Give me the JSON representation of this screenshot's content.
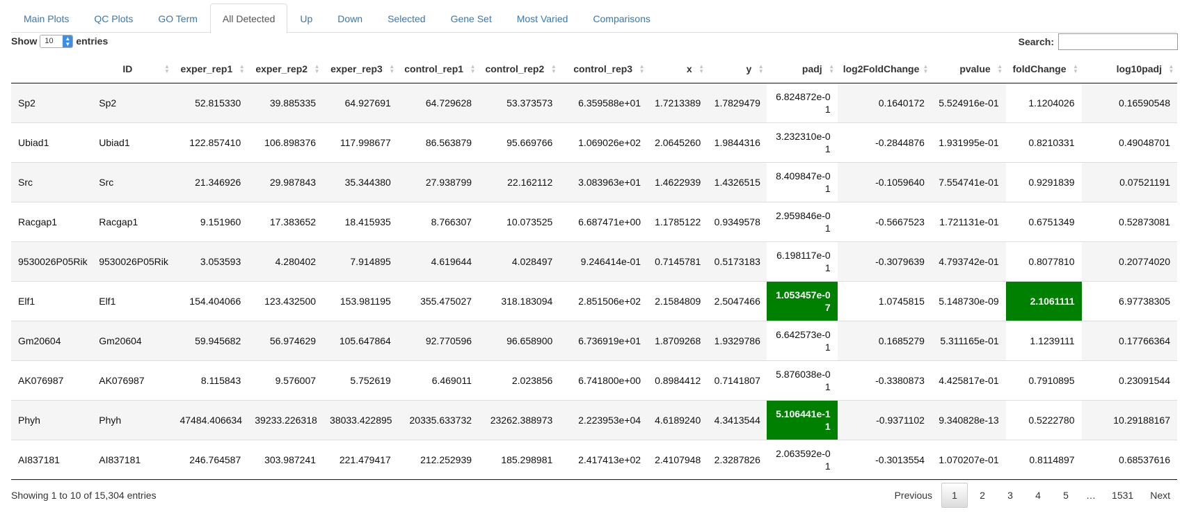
{
  "tabs": [
    {
      "label": "Main Plots",
      "active": false
    },
    {
      "label": "QC Plots",
      "active": false
    },
    {
      "label": "GO Term",
      "active": false
    },
    {
      "label": "All Detected",
      "active": true
    },
    {
      "label": "Up",
      "active": false
    },
    {
      "label": "Down",
      "active": false
    },
    {
      "label": "Selected",
      "active": false
    },
    {
      "label": "Gene Set",
      "active": false
    },
    {
      "label": "Most Varied",
      "active": false
    },
    {
      "label": "Comparisons",
      "active": false
    }
  ],
  "length": {
    "show_label": "Show",
    "value": "10",
    "entries_label": "entries"
  },
  "search": {
    "label": "Search:",
    "value": ""
  },
  "table": {
    "headers": [
      "",
      "ID",
      "exper_rep1",
      "exper_rep2",
      "exper_rep3",
      "control_rep1",
      "control_rep2",
      "control_rep3",
      "x",
      "y",
      "padj",
      "log2FoldChange",
      "pvalue",
      "foldChange",
      "log10padj"
    ],
    "rows": [
      [
        "Sp2",
        "Sp2",
        "52.815330",
        "39.885335",
        "64.927691",
        "64.729628",
        "53.373573",
        "6.359588e+01",
        "1.7213389",
        "1.7829479",
        "6.824872e-01",
        "0.1640172",
        "5.524916e-01",
        "1.1204026",
        "0.16590548"
      ],
      [
        "Ubiad1",
        "Ubiad1",
        "122.857410",
        "106.898376",
        "117.998677",
        "86.563879",
        "95.669766",
        "1.069026e+02",
        "2.0645260",
        "1.9844316",
        "3.232310e-01",
        "-0.2844876",
        "1.931995e-01",
        "0.8210331",
        "0.49048701"
      ],
      [
        "Src",
        "Src",
        "21.346926",
        "29.987843",
        "35.344380",
        "27.938799",
        "22.162112",
        "3.083963e+01",
        "1.4622939",
        "1.4326515",
        "8.409847e-01",
        "-0.1059640",
        "7.554741e-01",
        "0.9291839",
        "0.07521191"
      ],
      [
        "Racgap1",
        "Racgap1",
        "9.151960",
        "17.383652",
        "18.415935",
        "8.766307",
        "10.073525",
        "6.687471e+00",
        "1.1785122",
        "0.9349578",
        "2.959846e-01",
        "-0.5667523",
        "1.721131e-01",
        "0.6751349",
        "0.52873081"
      ],
      [
        "9530026P05Rik",
        "9530026P05Rik",
        "3.053593",
        "4.280402",
        "7.914895",
        "4.619644",
        "4.028497",
        "9.246414e-01",
        "0.7145781",
        "0.5173183",
        "6.198117e-01",
        "-0.3079639",
        "4.793742e-01",
        "0.8077810",
        "0.20774020"
      ],
      [
        "Elf1",
        "Elf1",
        "154.404066",
        "123.432500",
        "153.981195",
        "355.475027",
        "318.183094",
        "2.851506e+02",
        "2.1584809",
        "2.5047466",
        "1.053457e-07",
        "1.0745815",
        "5.148730e-09",
        "2.1061111",
        "6.97738305"
      ],
      [
        "Gm20604",
        "Gm20604",
        "59.945682",
        "56.974629",
        "105.647864",
        "92.770596",
        "96.658900",
        "6.736919e+01",
        "1.8709268",
        "1.9329786",
        "6.642573e-01",
        "0.1685279",
        "5.311165e-01",
        "1.1239111",
        "0.17766364"
      ],
      [
        "AK076987",
        "AK076987",
        "8.115843",
        "9.576007",
        "5.752619",
        "6.469011",
        "2.023856",
        "6.741800e+00",
        "0.8984412",
        "0.7141807",
        "5.876038e-01",
        "-0.3380873",
        "4.425817e-01",
        "0.7910895",
        "0.23091544"
      ],
      [
        "Phyh",
        "Phyh",
        "47484.406634",
        "39233.226318",
        "38033.422895",
        "20335.633732",
        "23262.388973",
        "2.223953e+04",
        "4.6189240",
        "4.3413544",
        "5.106441e-11",
        "-0.9371102",
        "9.340828e-13",
        "0.5222780",
        "10.29188167"
      ],
      [
        "AI837181",
        "AI837181",
        "246.764587",
        "303.987241",
        "221.479417",
        "212.252939",
        "185.298981",
        "2.417413e+02",
        "2.4107948",
        "2.3287826",
        "2.063592e-01",
        "-0.3013554",
        "1.070207e-01",
        "0.8114897",
        "0.68537616"
      ]
    ],
    "highlight": {
      "color": "#008000",
      "padj_highlight_rows": [
        5,
        8
      ],
      "foldchange_highlight_rows": [
        5
      ]
    }
  },
  "info": "Showing 1 to 10 of 15,304 entries",
  "pagination": {
    "previous": "Previous",
    "pages": [
      "1",
      "2",
      "3",
      "4",
      "5"
    ],
    "current": "1",
    "ellipsis": "…",
    "last": "1531",
    "next": "Next"
  }
}
